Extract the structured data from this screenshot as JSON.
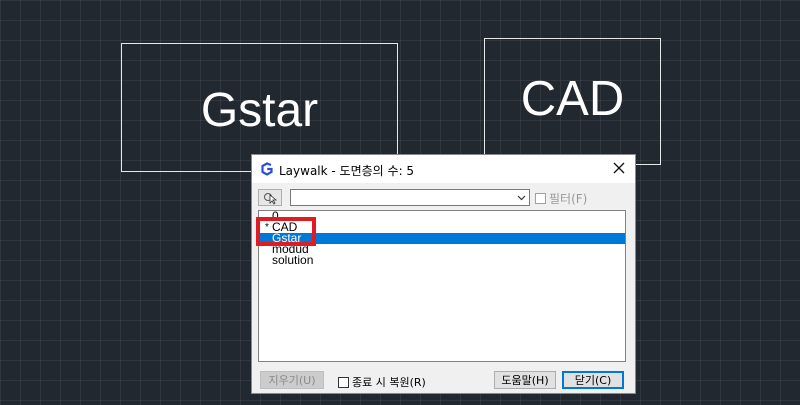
{
  "canvas": {
    "texts": [
      "Gstar",
      "CAD"
    ]
  },
  "dialog": {
    "title": "Laywalk - 도면층의 수: 5",
    "filter_label": "필터(F)",
    "combo_value": "",
    "layers": [
      {
        "mark": "",
        "name": "0"
      },
      {
        "mark": "*",
        "name": "CAD"
      },
      {
        "mark": "",
        "name": "Gstar"
      },
      {
        "mark": "",
        "name": "modud"
      },
      {
        "mark": "",
        "name": "solution"
      }
    ],
    "selected_index": 2,
    "buttons": {
      "delete": "지우기(U)",
      "restore": "종료 시 복원(R)",
      "help": "도움말(H)",
      "close": "닫기(C)"
    }
  },
  "colors": {
    "selection": "#0078d7",
    "highlight": "#e01b22",
    "background": "#212830"
  }
}
